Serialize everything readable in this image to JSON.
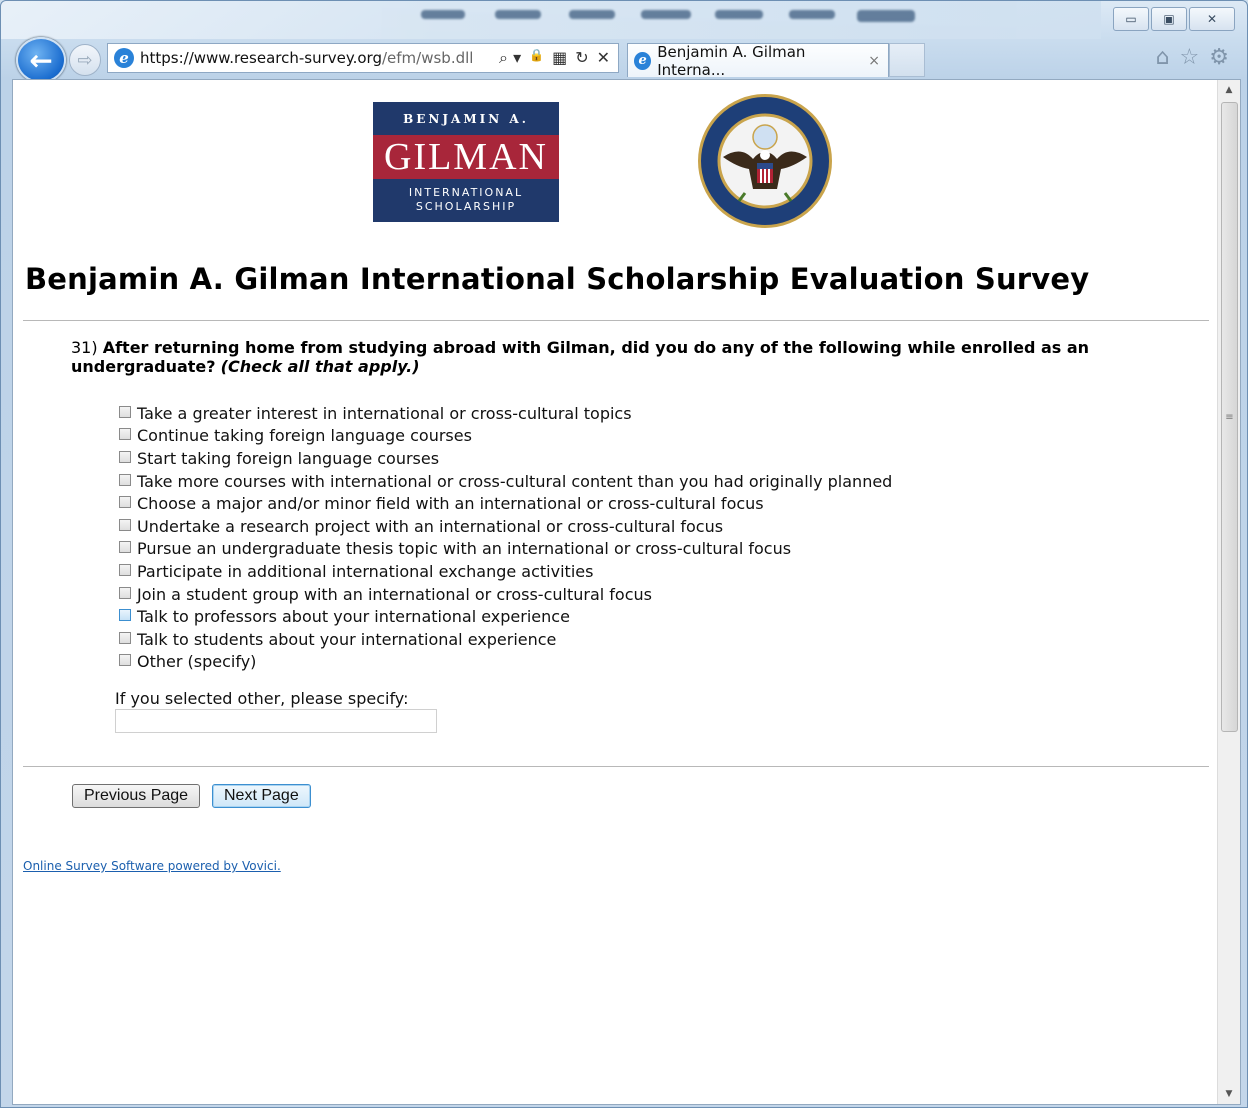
{
  "browser": {
    "url_host": "https://www.research-survey.org",
    "url_path": "/efm/wsb.dll",
    "tab_title": "Benjamin A. Gilman Interna...",
    "tab_close": "×",
    "ie_glyph": "e",
    "back_glyph": "←",
    "forward_glyph": "⇨",
    "window_controls": {
      "minimize": "▭",
      "maximize": "▣",
      "close": "✕"
    },
    "address_icons": {
      "search": "⌕ ▾",
      "lock": "🔒",
      "compat": "▦",
      "refresh": "↻",
      "stop": "✕"
    },
    "toolbar_icons": {
      "home": "⌂",
      "favorites": "☆",
      "tools": "⚙"
    }
  },
  "logos": {
    "gilman": {
      "top": "BENJAMIN A.",
      "main": "GILMAN",
      "bottom_1": "INTERNATIONAL",
      "bottom_2": "SCHOLARSHIP"
    }
  },
  "page": {
    "title": "Benjamin A. Gilman International Scholarship Evaluation Survey"
  },
  "question": {
    "number": "31)",
    "text": "After returning home from studying abroad with Gilman, did you do any of the following while enrolled as an undergraduate?",
    "note": "(Check all that apply.)",
    "options": [
      "Take a greater interest in international or cross-cultural topics",
      "Continue taking foreign language courses",
      "Start taking foreign language courses",
      "Take more courses with international or cross-cultural content than you had originally planned",
      "Choose a major and/or minor field with an international or cross-cultural focus",
      "Undertake a research project with an international or cross-cultural focus",
      "Pursue an undergraduate thesis topic with an international or cross-cultural focus",
      "Participate in additional international exchange activities",
      "Join a student group with an international or cross-cultural focus",
      "Talk to professors about your international experience",
      "Talk to students about your international experience",
      "Other (specify)"
    ],
    "specify_label": "If you selected other, please specify:",
    "specify_value": ""
  },
  "buttons": {
    "previous": "Previous Page",
    "next": "Next Page"
  },
  "footer": {
    "link": "Online Survey Software powered by Vovici."
  },
  "scrollbar": {
    "up": "▲",
    "down": "▼",
    "grip": "≡"
  },
  "colors": {
    "logo_navy": "#20396b",
    "logo_red": "#a8263a",
    "link": "#1b5fae"
  }
}
